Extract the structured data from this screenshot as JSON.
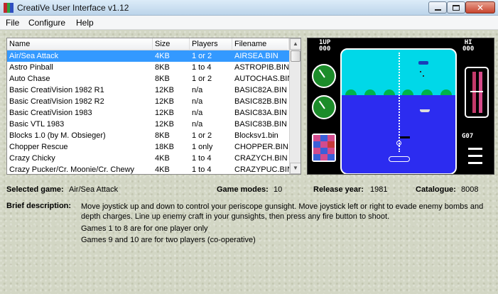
{
  "window": {
    "title": "CreatiVe User Interface v1.12",
    "icon_colors": [
      "#c0282d",
      "#2fa33c",
      "#2f4fc0"
    ],
    "buttons": {
      "minimize": "minimize-icon",
      "maximize": "maximize-icon",
      "close": "close-icon",
      "close_glyph": "✕"
    }
  },
  "menu": {
    "items": [
      "File",
      "Configure",
      "Help"
    ]
  },
  "games_list": {
    "columns": [
      "Name",
      "Size",
      "Players",
      "Filename"
    ],
    "selected_index": 0,
    "rows": [
      {
        "name": "Air/Sea Attack",
        "size": "4KB",
        "players": "1 or 2",
        "filename": "AIRSEA.BIN"
      },
      {
        "name": "Astro Pinball",
        "size": "8KB",
        "players": "1 to 4",
        "filename": "ASTROPIB.BIN"
      },
      {
        "name": "Auto Chase",
        "size": "8KB",
        "players": "1 or 2",
        "filename": "AUTOCHAS.BIN"
      },
      {
        "name": "Basic CreatiVision 1982 R1",
        "size": "12KB",
        "players": "n/a",
        "filename": "BASIC82A.BIN"
      },
      {
        "name": "Basic CreatiVision 1982 R2",
        "size": "12KB",
        "players": "n/a",
        "filename": "BASIC82B.BIN"
      },
      {
        "name": "Basic CreatiVision 1983",
        "size": "12KB",
        "players": "n/a",
        "filename": "BASIC83A.BIN"
      },
      {
        "name": "Basic VTL 1983",
        "size": "12KB",
        "players": "n/a",
        "filename": "BASIC83B.BIN"
      },
      {
        "name": "Blocks 1.0 (by M. Obsieger)",
        "size": "8KB",
        "players": "1 or 2",
        "filename": "Blocksv1.bin"
      },
      {
        "name": "Chopper Rescue",
        "size": "18KB",
        "players": "1 only",
        "filename": "CHOPPER.BIN"
      },
      {
        "name": "Crazy Chicky",
        "size": "4KB",
        "players": "1 to 4",
        "filename": "CRAZYCH.BIN"
      },
      {
        "name": "Crazy Pucker/Cr. Moonie/Cr. Chewy",
        "size": "4KB",
        "players": "1 to 4",
        "filename": "CRAZYPUC.BIN"
      }
    ],
    "scroll_up_glyph": "▲",
    "scroll_down_glyph": "▼"
  },
  "screenshot": {
    "hud_left": "1UP\n000",
    "hud_right": "HI\n000",
    "hud_bottom": "G07",
    "colors": {
      "sky": "#00d8e8",
      "sea": "#2c2cf0",
      "trees": "#00b44a",
      "gauge": "#1c8c2a",
      "bar": "#c43a6a"
    },
    "depth_colors": [
      "#d34b8e",
      "#3b5fd8",
      "#d34b8e",
      "#3b5fd8",
      "#d34b8e",
      "#c83a3a",
      "#d34b8e",
      "#3b5fd8",
      "#d34b8e",
      "#3b5fd8",
      "#d34b8e",
      "#3b5fd8"
    ]
  },
  "details": {
    "selected_game_label": "Selected game:",
    "selected_game_value": "Air/Sea Attack",
    "game_modes_label": "Game modes:",
    "game_modes_value": "10",
    "release_year_label": "Release year:",
    "release_year_value": "1981",
    "catalogue_label": "Catalogue:",
    "catalogue_value": "8008",
    "brief_label": "Brief description:",
    "description_lines": [
      "Move joystick up and down to control your periscope gunsight. Move joystick left or right to evade enemy bombs and",
      "depth charges. Line up enemy craft in your gunsights, then press any fire button to shoot.",
      "Games 1 to 8 are for one player only",
      "Games 9 and 10 are for two players (co-operative)"
    ]
  }
}
